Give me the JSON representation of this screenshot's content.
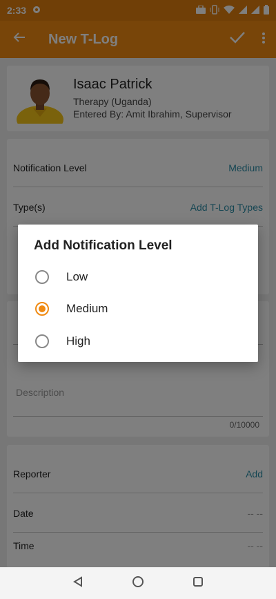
{
  "status_bar": {
    "time": "2:33",
    "icons": [
      "gear-icon",
      "briefcase-icon",
      "vibrate-icon",
      "wifi-icon",
      "signal-icon",
      "signal-icon",
      "battery-icon"
    ]
  },
  "app_bar": {
    "title": "New T-Log",
    "back_icon": "arrow-left-icon",
    "save_icon": "check-icon",
    "more_icon": "more-vertical-icon"
  },
  "profile": {
    "name": "Isaac Patrick",
    "program": "Therapy (Uganda)",
    "entered_by": "Entered By: Amit Ibrahim, Supervisor"
  },
  "form": {
    "notification_label": "Notification Level",
    "notification_value": "Medium",
    "types_label": "Type(s)",
    "types_action": "Add T-Log Types",
    "description_placeholder": "Description",
    "description_counter": "0/10000",
    "reporter_label": "Reporter",
    "reporter_action": "Add",
    "date_label": "Date",
    "date_value": "-- --",
    "time_label": "Time",
    "time_value": "-- --"
  },
  "dialog": {
    "title": "Add Notification Level",
    "options": [
      {
        "label": "Low",
        "selected": false
      },
      {
        "label": "Medium",
        "selected": true
      },
      {
        "label": "High",
        "selected": false
      }
    ]
  },
  "colors": {
    "primary": "#f08a12",
    "link": "#2b8ca6"
  }
}
